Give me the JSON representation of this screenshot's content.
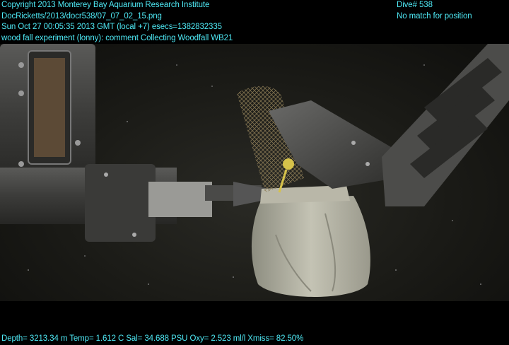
{
  "overlay": {
    "copyright": "Copyright 2013 Monterey Bay Aquarium Research Institute",
    "file_path": "DocRicketts/2013/docr538/07_07_02_15.png",
    "timestamp": "Sun Oct 27 00:05:35 2013 GMT (local +7)  esecs=1382832335",
    "comment": "wood fall experiment (lonny): comment Collecting Woodfall WB21",
    "dive": "Dive# 538",
    "position_status": "No match for position",
    "telemetry": "Depth= 3213.34 m  Temp= 1.612 C  Sal= 34.688 PSU  Oxy= 2.523 ml/l  Xmiss= 82.50%"
  },
  "colors": {
    "overlay_text": "#4ee8f4",
    "background": "#000000"
  }
}
